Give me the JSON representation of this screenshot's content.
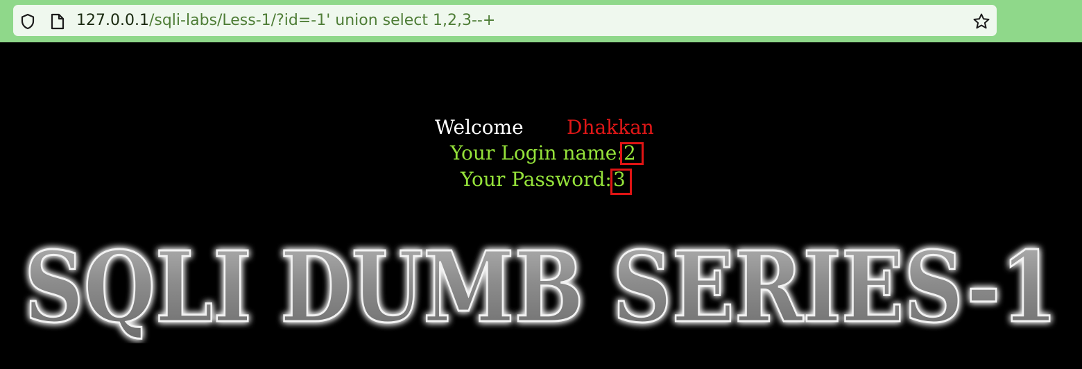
{
  "browser": {
    "url_host": "127.0.0.1",
    "url_path": "/sqli-labs/Less-1/?id=-1' union select 1,2,3--+",
    "icons": {
      "left_security": "shield-icon",
      "page_info": "page-icon",
      "bookmark": "star-icon"
    }
  },
  "result": {
    "welcome_label": "Welcome",
    "welcome_user": "Dhakkan",
    "login_label": "Your Login name:",
    "login_value": "2",
    "password_label": "Your Password:",
    "password_value": "3"
  },
  "banner": {
    "title": "SQLI DUMB SERIES-1"
  },
  "colors": {
    "chrome_bar": "#8fd88a",
    "url_field": "#eff8ee",
    "page_background": "#000000",
    "welcome_text": "#ffffff",
    "username_text": "#e01717",
    "output_text": "#95e23a",
    "highlight_box": "#e01414",
    "banner_fill": "#8a8a8a"
  }
}
